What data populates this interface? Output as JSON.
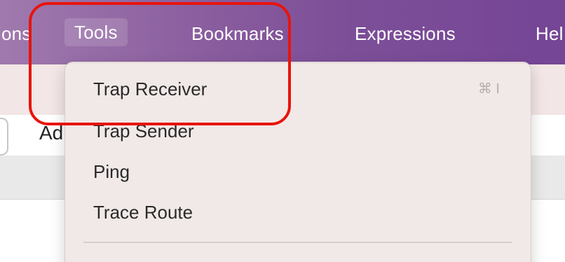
{
  "menubar": {
    "items": [
      {
        "label": "ions"
      },
      {
        "label": "Tools"
      },
      {
        "label": "Bookmarks"
      },
      {
        "label": "Expressions"
      },
      {
        "label": "Hel"
      }
    ],
    "active_item": "Tools"
  },
  "background": {
    "address_text": "Ad"
  },
  "dropdown": {
    "items": [
      {
        "label": "Trap Receiver",
        "shortcut": "⌘ I"
      },
      {
        "label": "Trap Sender",
        "shortcut": ""
      },
      {
        "label": "Ping",
        "shortcut": ""
      },
      {
        "label": "Trace Route",
        "shortcut": ""
      }
    ]
  },
  "colors": {
    "menubar_start": "#a07aae",
    "menubar_end": "#754596",
    "dropdown_bg": "#f1e8e6",
    "highlight": "#e8140c"
  }
}
